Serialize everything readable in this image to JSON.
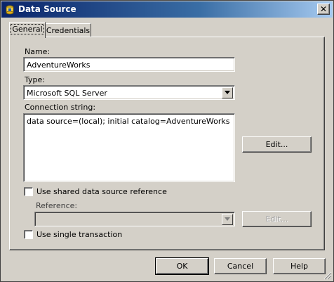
{
  "window": {
    "title": "Data Source",
    "close_symbol": "✕"
  },
  "tabs": [
    {
      "label": "General",
      "active": true
    },
    {
      "label": "Credentials",
      "active": false
    }
  ],
  "general": {
    "name_label": "Name:",
    "name_value": "AdventureWorks",
    "type_label": "Type:",
    "type_value": "Microsoft SQL Server",
    "connection_label": "Connection string:",
    "connection_value": "data source=(local); initial catalog=AdventureWorks",
    "edit_label": "Edit...",
    "shared_label": "Use shared data source reference",
    "shared_checked": false,
    "reference_label": "Reference:",
    "reference_value": "",
    "reference_edit_label": "Edit...",
    "single_transaction_label": "Use single transaction",
    "single_transaction_checked": false
  },
  "footer": {
    "ok_label": "OK",
    "cancel_label": "Cancel",
    "help_label": "Help"
  },
  "icons": {
    "app": "data-source-icon",
    "close": "close-icon",
    "dropdown": "chevron-down-icon",
    "grip": "resize-grip-icon"
  },
  "colors": {
    "titlebar_start": "#0a246a",
    "titlebar_end": "#a6caf0",
    "face": "#d4d0c8"
  }
}
